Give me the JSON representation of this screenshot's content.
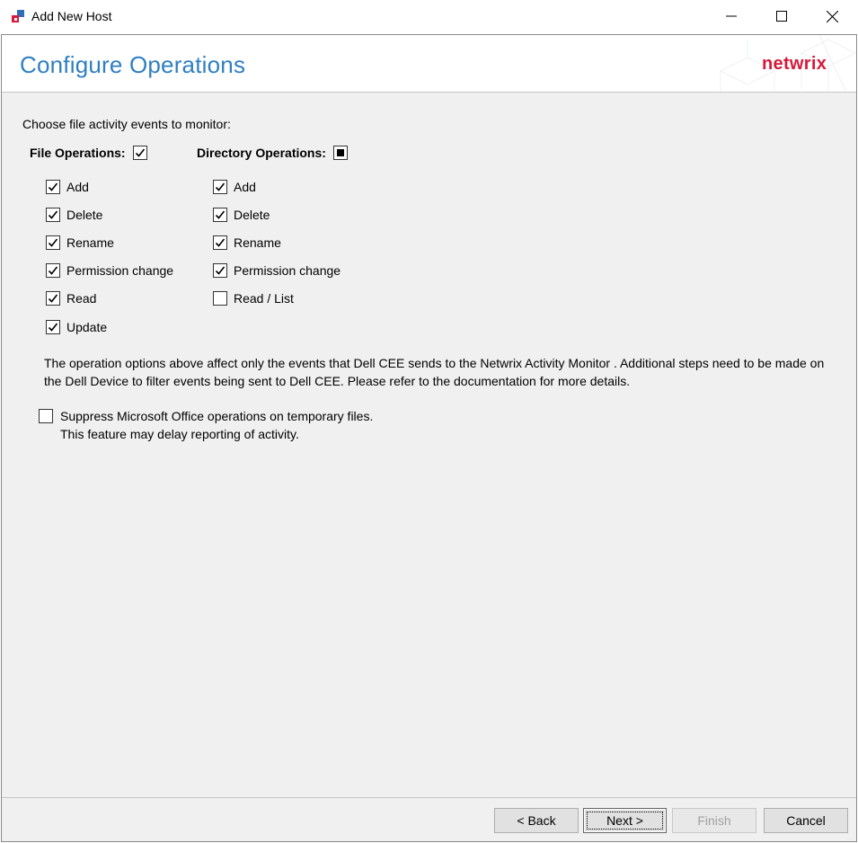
{
  "window": {
    "title": "Add New Host",
    "icon": "netwrix-app-icon"
  },
  "header": {
    "title": "Configure Operations",
    "logo": "netwrix"
  },
  "content": {
    "prompt": "Choose file activity events to monitor:",
    "file_operations": {
      "label": "File Operations:",
      "state": "checked",
      "items": [
        {
          "label": "Add",
          "checked": true
        },
        {
          "label": "Delete",
          "checked": true
        },
        {
          "label": "Rename",
          "checked": true
        },
        {
          "label": "Permission change",
          "checked": true
        },
        {
          "label": "Read",
          "checked": true
        },
        {
          "label": "Update",
          "checked": true
        }
      ]
    },
    "directory_operations": {
      "label": "Directory Operations:",
      "state": "indeterminate",
      "items": [
        {
          "label": "Add",
          "checked": true
        },
        {
          "label": "Delete",
          "checked": true
        },
        {
          "label": "Rename",
          "checked": true
        },
        {
          "label": "Permission change",
          "checked": true
        },
        {
          "label": "Read / List",
          "checked": false
        }
      ]
    },
    "note": "The operation options above affect only the events that Dell CEE sends to the Netwrix Activity Monitor . Additional steps need to be made on the Dell Device to filter events being sent to Dell CEE. Please refer to the documentation for more details.",
    "suppress": {
      "label": "Suppress Microsoft Office operations on temporary files.",
      "sublabel": "This feature may delay reporting of activity.",
      "checked": false
    }
  },
  "footer": {
    "back": "< Back",
    "next": "Next >",
    "finish": "Finish",
    "cancel": "Cancel"
  }
}
